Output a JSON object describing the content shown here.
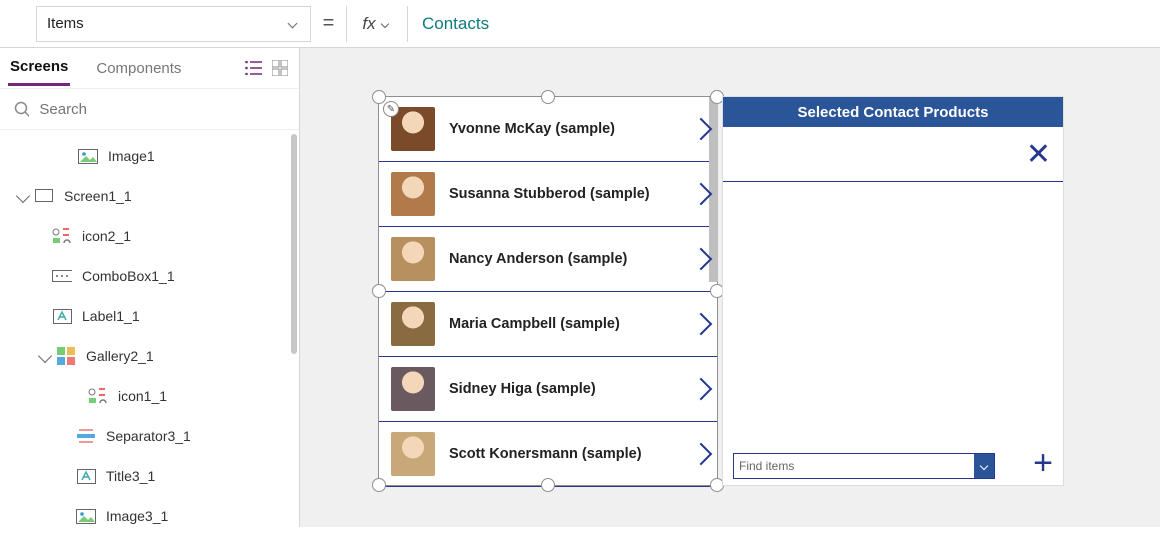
{
  "formula": {
    "property": "Items",
    "value": "Contacts"
  },
  "tabs": {
    "screens": "Screens",
    "components": "Components"
  },
  "search": {
    "placeholder": "Search"
  },
  "tree": {
    "image1": "Image1",
    "screen1": "Screen1_1",
    "icon2": "icon2_1",
    "combobox1": "ComboBox1_1",
    "label1": "Label1_1",
    "gallery2": "Gallery2_1",
    "icon1": "icon1_1",
    "separator3": "Separator3_1",
    "title3": "Title3_1",
    "image3": "Image3_1"
  },
  "gallery": [
    {
      "name": "Yvonne McKay (sample)"
    },
    {
      "name": "Susanna Stubberod (sample)"
    },
    {
      "name": "Nancy Anderson (sample)"
    },
    {
      "name": "Maria Campbell (sample)"
    },
    {
      "name": "Sidney Higa (sample)"
    },
    {
      "name": "Scott Konersmann (sample)"
    }
  ],
  "card": {
    "title": "Selected Contact Products",
    "find_placeholder": "Find items"
  },
  "avatar_bg": [
    "#7a4a2a",
    "#b07a4a",
    "#b89060",
    "#8a6a40",
    "#6a5a60",
    "#c8a878"
  ]
}
